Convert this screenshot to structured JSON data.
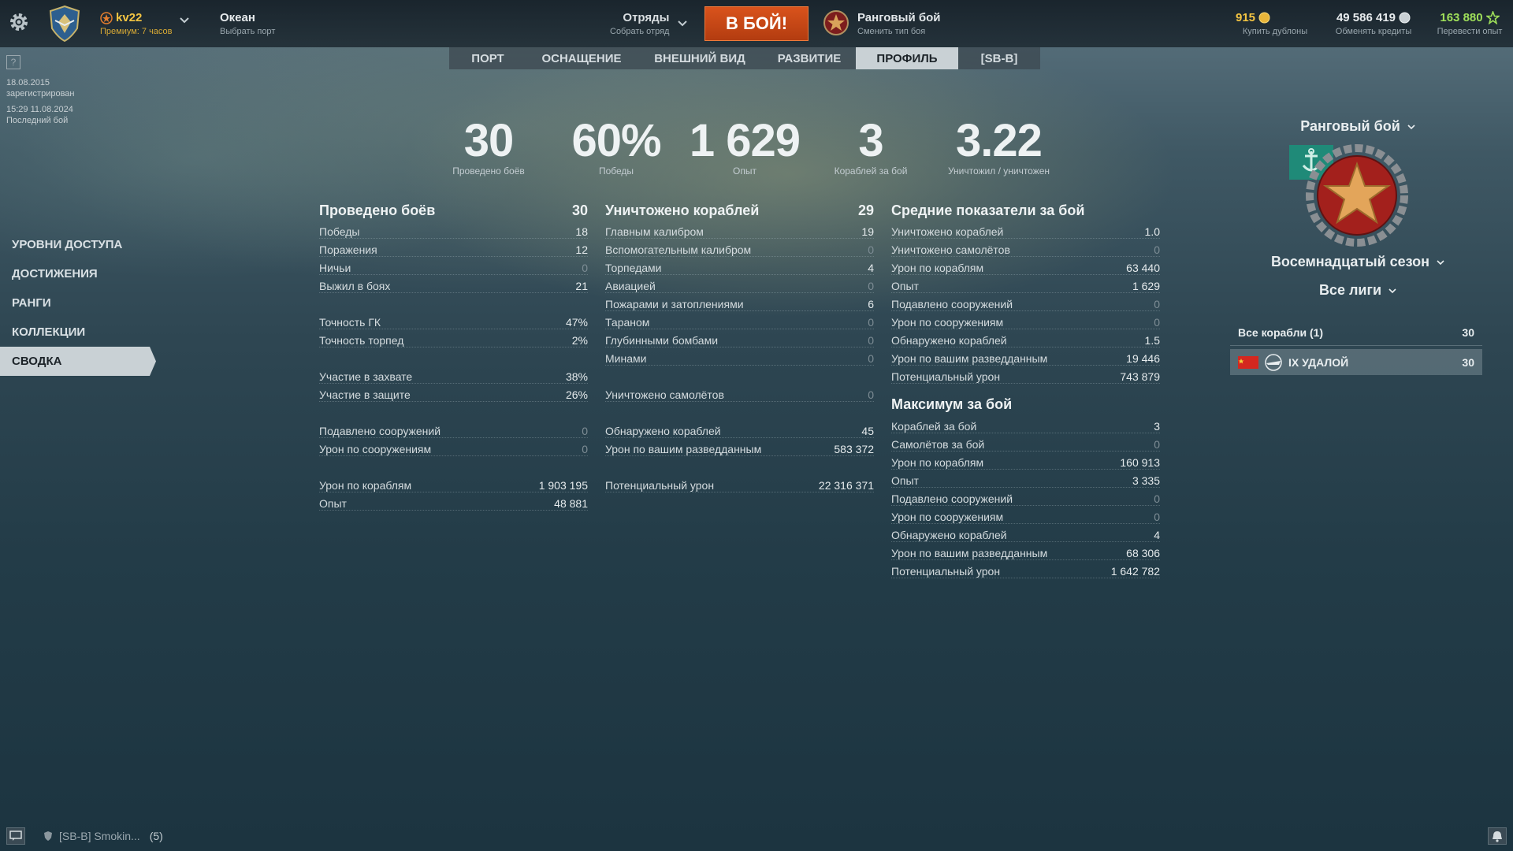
{
  "topbar": {
    "player_name": "kv22",
    "premium": "Премиум: 7 часов",
    "port_name": "Океан",
    "port_sub": "Выбрать порт",
    "squads": "Отряды",
    "squads_sub": "Собрать отряд",
    "battle_button": "В БОЙ!",
    "battle_type": "Ранговый бой",
    "battle_type_sub": "Сменить тип боя",
    "doubloons": "915",
    "doubloons_sub": "Купить дублоны",
    "credits": "49 586 419",
    "credits_sub": "Обменять кредиты",
    "free_xp": "163 880",
    "free_xp_sub": "Перевести опыт"
  },
  "tabs": [
    "ПОРТ",
    "ОСНАЩЕНИЕ",
    "ВНЕШНИЙ ВИД",
    "РАЗВИТИЕ",
    "ПРОФИЛЬ",
    "[SB-B]"
  ],
  "meta": {
    "help": "?",
    "reg_date": "18.08.2015",
    "reg_label": "зарегистрирован",
    "last_battle": "15:29  11.08.2024",
    "last_battle_label": "Последний бой"
  },
  "left_menu": [
    "УРОВНИ ДОСТУПА",
    "ДОСТИЖЕНИЯ",
    "РАНГИ",
    "КОЛЛЕКЦИИ",
    "СВОДКА"
  ],
  "big_stats": [
    {
      "value": "30",
      "label": "Проведено боёв"
    },
    {
      "value": "60%",
      "label": "Победы"
    },
    {
      "value": "1 629",
      "label": "Опыт"
    },
    {
      "value": "3",
      "label": "Кораблей за бой"
    },
    {
      "value": "3.22",
      "label": "Уничтожил / уничтожен"
    }
  ],
  "col1": {
    "title": "Проведено боёв",
    "total": "30",
    "rows": [
      {
        "label": "Победы",
        "value": "18"
      },
      {
        "label": "Поражения",
        "value": "12"
      },
      {
        "label": "Ничьи",
        "value": "0"
      },
      {
        "label": "Выжил в боях",
        "value": "21"
      },
      {
        "label": "Точность ГК",
        "value": "47%"
      },
      {
        "label": "Точность торпед",
        "value": "2%"
      },
      {
        "label": "Участие в захвате",
        "value": "38%"
      },
      {
        "label": "Участие в защите",
        "value": "26%"
      },
      {
        "label": "Подавлено сооружений",
        "value": "0"
      },
      {
        "label": "Урон по сооружениям",
        "value": "0"
      },
      {
        "label": "Урон по кораблям",
        "value": "1 903 195"
      },
      {
        "label": "Опыт",
        "value": "48 881"
      }
    ]
  },
  "col2": {
    "title": "Уничтожено кораблей",
    "total": "29",
    "rows": [
      {
        "label": "Главным калибром",
        "value": "19"
      },
      {
        "label": "Вспомогательным калибром",
        "value": "0"
      },
      {
        "label": "Торпедами",
        "value": "4"
      },
      {
        "label": "Авиацией",
        "value": "0"
      },
      {
        "label": "Пожарами и затоплениями",
        "value": "6"
      },
      {
        "label": "Тараном",
        "value": "0"
      },
      {
        "label": "Глубинными бомбами",
        "value": "0"
      },
      {
        "label": "Минами",
        "value": "0"
      },
      {
        "label": "Уничтожено самолётов",
        "value": "0"
      },
      {
        "label": "Обнаружено кораблей",
        "value": "45"
      },
      {
        "label": "Урон по вашим разведданным",
        "value": "583 372"
      },
      {
        "label": "Потенциальный урон",
        "value": "22 316 371"
      }
    ]
  },
  "col3": {
    "title": "Средние показатели за бой",
    "rows": [
      {
        "label": "Уничтожено кораблей",
        "value": "1.0"
      },
      {
        "label": "Уничтожено самолётов",
        "value": "0"
      },
      {
        "label": "Урон по кораблям",
        "value": "63 440"
      },
      {
        "label": "Опыт",
        "value": "1 629"
      },
      {
        "label": "Подавлено сооружений",
        "value": "0"
      },
      {
        "label": "Урон по сооружениям",
        "value": "0"
      },
      {
        "label": "Обнаружено кораблей",
        "value": "1.5"
      },
      {
        "label": "Урон по вашим разведданным",
        "value": "19 446"
      },
      {
        "label": "Потенциальный урон",
        "value": "743 879"
      }
    ],
    "max_title": "Максимум за бой",
    "max_rows": [
      {
        "label": "Кораблей за бой",
        "value": "3"
      },
      {
        "label": "Самолётов за бой",
        "value": "0"
      },
      {
        "label": "Урон по кораблям",
        "value": "160 913"
      },
      {
        "label": "Опыт",
        "value": "3 335"
      },
      {
        "label": "Подавлено сооружений",
        "value": "0"
      },
      {
        "label": "Урон по сооружениям",
        "value": "0"
      },
      {
        "label": "Обнаружено кораблей",
        "value": "4"
      },
      {
        "label": "Урон по вашим разведданным",
        "value": "68 306"
      },
      {
        "label": "Потенциальный урон",
        "value": "1 642 782"
      }
    ]
  },
  "right_panel": {
    "mode": "Ранговый бой",
    "season": "Восемнадцатый сезон",
    "league": "Все лиги",
    "all_ships_label": "Все корабли (1)",
    "all_ships_count": "30",
    "ship_name": "IX УДАЛОЙ",
    "ship_count": "30"
  },
  "bottom": {
    "clan_chat": "[SB-B] Smokin...",
    "clan_count": "(5)"
  },
  "colors": {
    "accent_orange": "#d9531c",
    "gold": "#f4c542",
    "xp_green": "#9fe05a",
    "active_tab": "#c9d1d5"
  }
}
